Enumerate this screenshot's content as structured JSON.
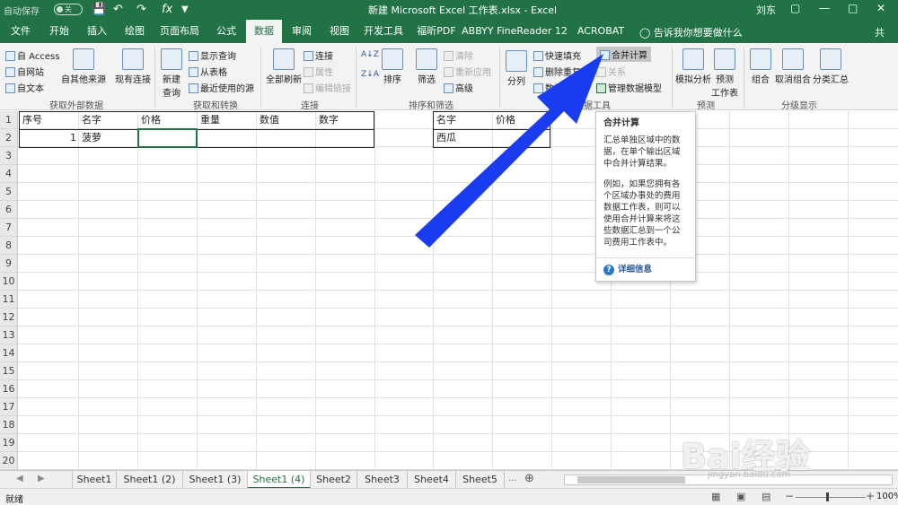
{
  "titlebar": {
    "autosave": "自动保存",
    "toggle": "关",
    "title": "新建 Microsoft Excel 工作表.xlsx  -  Excel",
    "user": "刘东"
  },
  "tabs": [
    "文件",
    "开始",
    "插入",
    "绘图",
    "页面布局",
    "公式",
    "数据",
    "审阅",
    "视图",
    "开发工具",
    "福昕PDF",
    "ABBYY FineReader 12",
    "ACROBAT"
  ],
  "active_tab": "数据",
  "tell_me": "告诉我你想要做什么",
  "share": "共",
  "ribbon": {
    "ext": {
      "access": "自 Access",
      "web": "自网站",
      "text": "自文本",
      "other": "自其他来源",
      "existing": "现有连接",
      "label": "获取外部数据"
    },
    "transform": {
      "newquery": "新建\n查询",
      "show": "显示查询",
      "fromtable": "从表格",
      "recent": "最近使用的源",
      "label": "获取和转换"
    },
    "conn": {
      "refresh": "全部刷新",
      "connections": "连接",
      "props": "属性",
      "editlinks": "编辑链接",
      "label": "连接"
    },
    "sort": {
      "sort": "排序",
      "filter": "筛选",
      "clear": "清除",
      "reapply": "重新应用",
      "advanced": "高级",
      "label": "排序和筛选"
    },
    "tools": {
      "split": "分列",
      "flash": "快速填充",
      "dedupe": "删除重复值",
      "validate": "数据验证",
      "consolidate": "合并计算",
      "relations": "关系",
      "model": "管理数据模型",
      "label": "数据工具"
    },
    "forecast": {
      "whatif": "模拟分析",
      "sheet": "预测\n工作表",
      "label": "预测"
    },
    "outline": {
      "group": "组合",
      "ungroup": "取消组合",
      "subtotal": "分类汇总",
      "label": "分级显示"
    }
  },
  "grid": {
    "rows": [
      "1",
      "2",
      "3",
      "4",
      "5",
      "6",
      "7",
      "8",
      "9",
      "10",
      "11",
      "12",
      "13",
      "14",
      "15",
      "16",
      "17",
      "18",
      "19",
      "20"
    ],
    "table1_headers": [
      "序号",
      "名字",
      "价格",
      "重量",
      "数值",
      "数字"
    ],
    "table1_row": {
      "index": "1",
      "name": "菠萝"
    },
    "table2_headers": [
      "名字",
      "价格"
    ],
    "table2_row": {
      "name": "西瓜"
    }
  },
  "tooltip": {
    "title": "合并计算",
    "para1": "汇总单独区域中的数据，在单个输出区域中合并计算结果。",
    "para2": "例如，如果您拥有各个区域办事处的费用数据工作表，则可以使用合并计算来将这些数据汇总到一个公司费用工作表中。",
    "more": "详细信息"
  },
  "sheets": [
    "Sheet1",
    "Sheet1 (2)",
    "Sheet1 (3)",
    "Sheet1 (4)",
    "Sheet2",
    "Sheet3",
    "Sheet4",
    "Sheet5"
  ],
  "active_sheet": "Sheet1 (4)",
  "status": {
    "ready": "就绪",
    "zoom": "100%"
  },
  "watermark": {
    "brand": "Bai经验",
    "url": "jingyan.baidu.com"
  },
  "colors": {
    "excel_green": "#217346",
    "arrow_blue": "#1a3cf0"
  }
}
